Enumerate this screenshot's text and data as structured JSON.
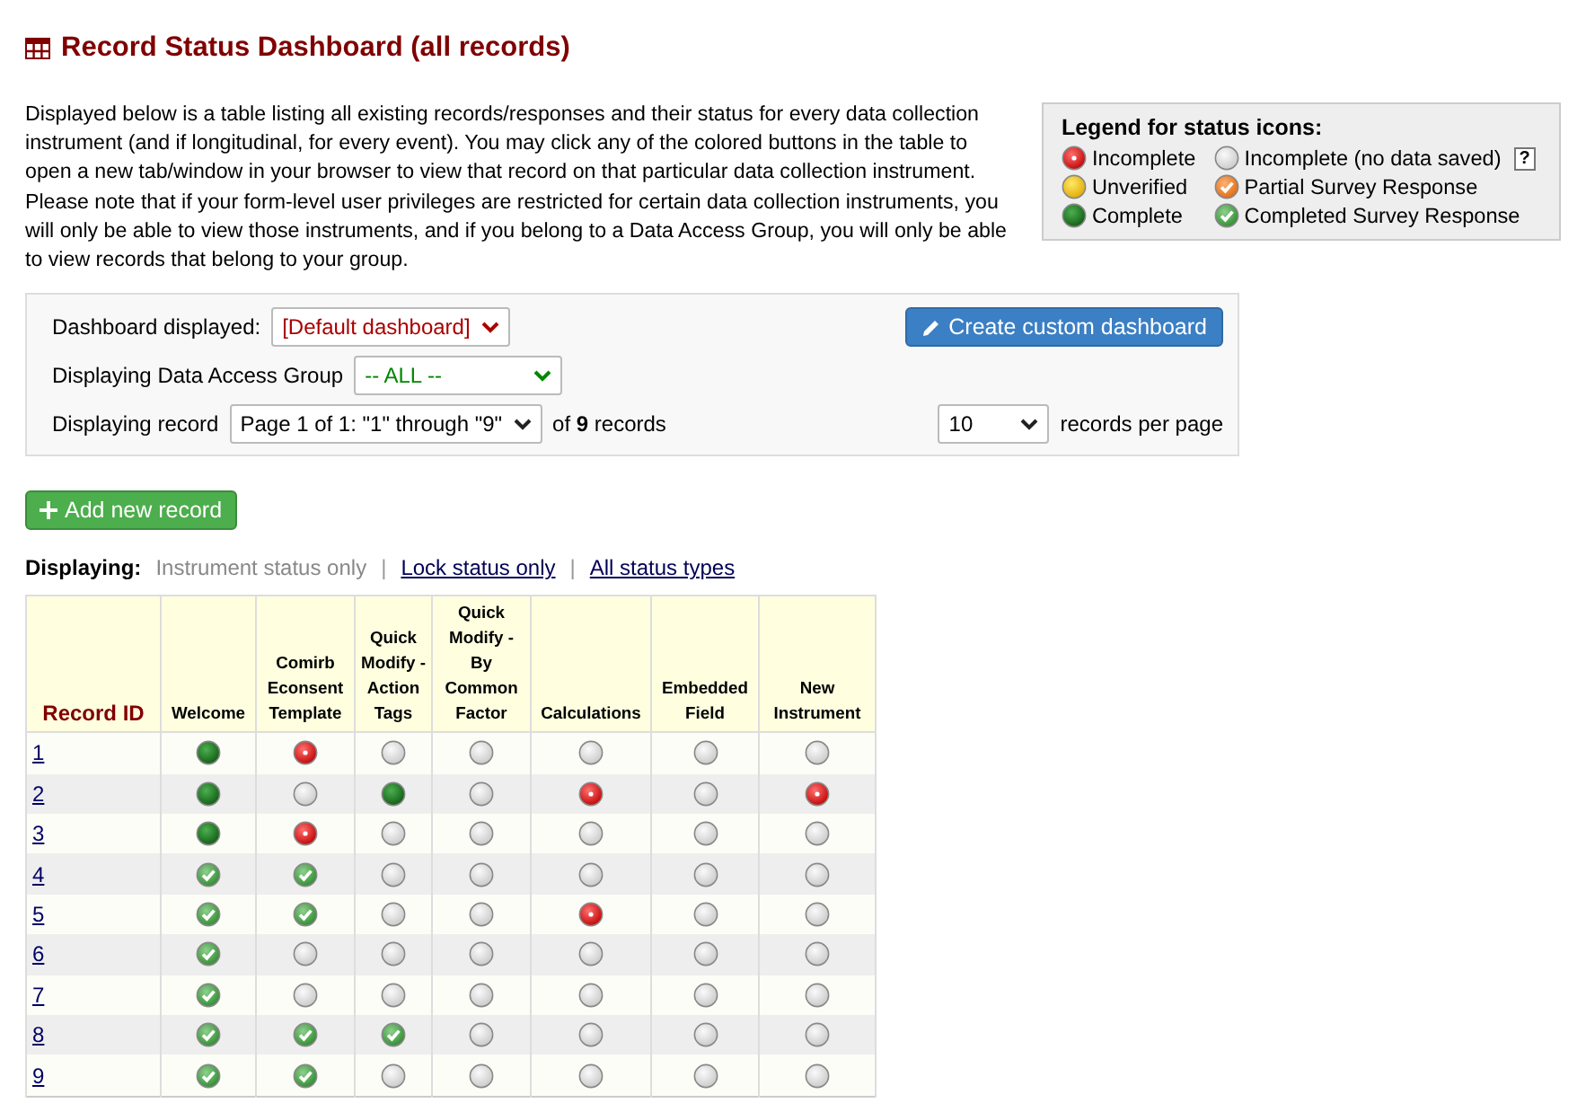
{
  "title": "Record Status Dashboard (all records)",
  "intro": "Displayed below is a table listing all existing records/responses and their status for every data collection instrument (and if longitudinal, for every event). You may click any of the colored buttons in the table to open a new tab/window in your browser to view that record on that particular data collection instrument. Please note that if your form-level user privileges are restricted for certain data collection instruments, you will only be able to view those instruments, and if you belong to a Data Access Group, you will only be able to view records that belong to your group.",
  "legend": {
    "title": "Legend for status icons:",
    "help": "?",
    "items": [
      {
        "kind": "incomplete",
        "label": "Incomplete"
      },
      {
        "kind": "empty",
        "label": "Incomplete (no data saved)"
      },
      {
        "kind": "unverified",
        "label": "Unverified"
      },
      {
        "kind": "partial",
        "label": "Partial Survey Response"
      },
      {
        "kind": "complete",
        "label": "Complete"
      },
      {
        "kind": "survey",
        "label": "Completed Survey Response"
      }
    ]
  },
  "controls": {
    "dashboard_label": "Dashboard displayed:",
    "dashboard_value": "[Default dashboard]",
    "create_button": "Create custom dashboard",
    "dag_label": "Displaying Data Access Group",
    "dag_value": "-- ALL --",
    "record_label": "Displaying record",
    "record_value": "Page 1 of 1: \"1\" through \"9\"",
    "record_count": "of **9** records",
    "per_page_value": "10",
    "per_page_label": "records per page"
  },
  "add_button": "Add new record",
  "display_mode": {
    "label": "Displaying:",
    "separators": [
      "|",
      "|"
    ],
    "options": [
      {
        "label": "Instrument status only",
        "selected": true
      },
      {
        "label": "Lock status only",
        "selected": false
      },
      {
        "label": "All status types",
        "selected": false
      }
    ]
  },
  "table": {
    "columns": [
      "Record ID",
      "Welcome",
      "Comirb Econsent Template",
      "Quick Modify - Action Tags",
      "Quick Modify - By Common Factor",
      "Calculations",
      "Embedded Field",
      "New Instrument"
    ],
    "rows": [
      {
        "record": "1",
        "cells": [
          {
            "kind": "complete"
          },
          {
            "kind": "incomplete"
          },
          {
            "kind": "empty"
          },
          {
            "kind": "empty"
          },
          {
            "kind": "empty"
          },
          {
            "kind": "empty"
          },
          {
            "kind": "empty"
          }
        ]
      },
      {
        "record": "2",
        "cells": [
          {
            "kind": "complete"
          },
          {
            "kind": "empty"
          },
          {
            "kind": "complete"
          },
          {
            "kind": "empty"
          },
          {
            "kind": "incomplete"
          },
          {
            "kind": "empty"
          },
          {
            "kind": "incomplete"
          }
        ]
      },
      {
        "record": "3",
        "cells": [
          {
            "kind": "complete"
          },
          {
            "kind": "incomplete"
          },
          {
            "kind": "empty"
          },
          {
            "kind": "empty"
          },
          {
            "kind": "empty"
          },
          {
            "kind": "empty"
          },
          {
            "kind": "empty"
          }
        ]
      },
      {
        "record": "4",
        "cells": [
          {
            "kind": "survey"
          },
          {
            "kind": "survey"
          },
          {
            "kind": "empty"
          },
          {
            "kind": "empty"
          },
          {
            "kind": "empty"
          },
          {
            "kind": "empty"
          },
          {
            "kind": "empty"
          }
        ]
      },
      {
        "record": "5",
        "cells": [
          {
            "kind": "survey"
          },
          {
            "kind": "survey"
          },
          {
            "kind": "empty"
          },
          {
            "kind": "empty"
          },
          {
            "kind": "incomplete"
          },
          {
            "kind": "empty"
          },
          {
            "kind": "empty"
          }
        ]
      },
      {
        "record": "6",
        "cells": [
          {
            "kind": "survey"
          },
          {
            "kind": "empty"
          },
          {
            "kind": "empty"
          },
          {
            "kind": "empty"
          },
          {
            "kind": "empty"
          },
          {
            "kind": "empty"
          },
          {
            "kind": "empty"
          }
        ]
      },
      {
        "record": "7",
        "cells": [
          {
            "kind": "survey"
          },
          {
            "kind": "empty"
          },
          {
            "kind": "empty"
          },
          {
            "kind": "empty"
          },
          {
            "kind": "empty"
          },
          {
            "kind": "empty"
          },
          {
            "kind": "empty"
          }
        ]
      },
      {
        "record": "8",
        "cells": [
          {
            "kind": "survey"
          },
          {
            "kind": "survey"
          },
          {
            "kind": "survey"
          },
          {
            "kind": "empty"
          },
          {
            "kind": "empty"
          },
          {
            "kind": "empty"
          },
          {
            "kind": "empty"
          }
        ]
      },
      {
        "record": "9",
        "cells": [
          {
            "kind": "survey"
          },
          {
            "kind": "survey"
          },
          {
            "kind": "empty"
          },
          {
            "kind": "empty"
          },
          {
            "kind": "empty"
          },
          {
            "kind": "empty"
          },
          {
            "kind": "empty"
          }
        ]
      }
    ]
  }
}
